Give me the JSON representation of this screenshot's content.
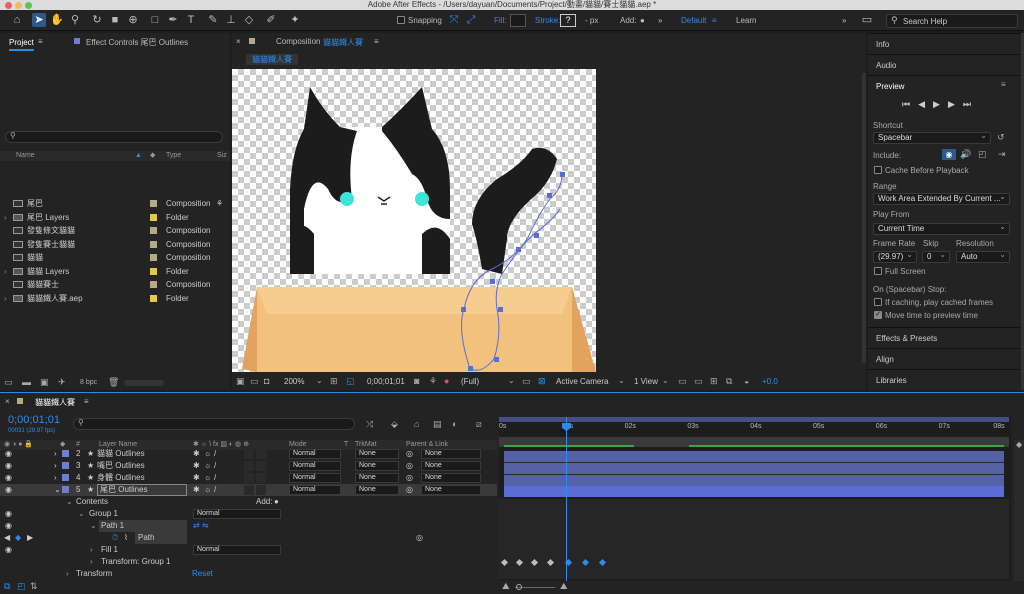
{
  "window": {
    "title": "Adobe After Effects - /Users/dayuan/Documents/Project/動畫/貓貓/賽士貓貓.aep *"
  },
  "toolbar": {
    "snapping": "Snapping",
    "fill": "Fill:",
    "stroke": "Stroke:",
    "stroke_value": "?",
    "px": "- px",
    "add": "Add:",
    "workspace_default": "Default",
    "workspace_learn": "Learn",
    "search_placeholder": "Search Help"
  },
  "project_panel": {
    "tab_project": "Project",
    "tab_effect_controls": "Effect Controls 尾巴 Outlines",
    "col_name": "Name",
    "col_type": "Type",
    "col_size": "Siz",
    "items": [
      {
        "name": "尾巴",
        "type": "Composition",
        "color": "#b5a98c"
      },
      {
        "name": "尾巴 Layers",
        "type": "Folder",
        "color": "#e3c84b"
      },
      {
        "name": "發隻條文貓貓",
        "type": "Composition",
        "color": "#b5a98c"
      },
      {
        "name": "發隻賽士貓貓",
        "type": "Composition",
        "color": "#b5a98c"
      },
      {
        "name": "貓貓",
        "type": "Composition",
        "color": "#b5a98c"
      },
      {
        "name": "貓貓 Layers",
        "type": "Folder",
        "color": "#e3c84b"
      },
      {
        "name": "貓貓賽士",
        "type": "Composition",
        "color": "#b5a98c"
      },
      {
        "name": "貓貓鐵人賽.aep",
        "type": "Folder",
        "color": "#e3c84b"
      }
    ],
    "bpc": "8 bpc"
  },
  "composition_panel": {
    "tab_label": "Composition",
    "tab_comp_name": "貓貓鐵人賽",
    "subtab": "貓貓鐵人賽",
    "zoom": "200%",
    "timecode": "0;00;01;01",
    "resolution": "(Full)",
    "camera": "Active Camera",
    "view": "1 View",
    "exposure": "+0.0"
  },
  "right_panel": {
    "info": "Info",
    "audio": "Audio",
    "preview": "Preview",
    "shortcut_label": "Shortcut",
    "shortcut_value": "Spacebar",
    "include_label": "Include:",
    "cache_before": "Cache Before Playback",
    "range_label": "Range",
    "range_value": "Work Area Extended By Current ...",
    "play_from_label": "Play From",
    "play_from_value": "Current Time",
    "frame_rate_label": "Frame Rate",
    "skip_label": "Skip",
    "resolution_label": "Resolution",
    "frame_rate_value": "(29.97)",
    "skip_value": "0",
    "resolution_value": "Auto",
    "full_screen": "Full Screen",
    "stop_label": "On (Spacebar) Stop:",
    "if_caching": "If caching, play cached frames",
    "move_time": "Move time to preview time",
    "effects_presets": "Effects & Presets",
    "align": "Align",
    "libraries": "Libraries"
  },
  "timeline": {
    "tab": "貓貓鐵人賽",
    "timecode": "0;00;01;01",
    "frame_info": "00031 (29.97 fps)",
    "col_hash": "#",
    "col_layer_name": "Layer Name",
    "col_mode": "Mode",
    "col_t": "T",
    "col_trkmat": "TrkMat",
    "col_parent": "Parent & Link",
    "ruler": [
      "0s",
      "01s",
      "02s",
      "03s",
      "04s",
      "05s",
      "06s",
      "07s",
      "08s"
    ],
    "layers": [
      {
        "num": "2",
        "name": "貓貓 Outlines",
        "mode": "Normal",
        "trkmat": "None",
        "parent": "None",
        "color": "#6f7fd0"
      },
      {
        "num": "3",
        "name": "嘴巴 Outlines",
        "mode": "Normal",
        "trkmat": "None",
        "parent": "None",
        "color": "#6f7fd0"
      },
      {
        "num": "4",
        "name": "身體 Outlines",
        "mode": "Normal",
        "trkmat": "None",
        "parent": "None",
        "color": "#6f7fd0"
      },
      {
        "num": "5",
        "name": "尾巴 Outlines",
        "mode": "Normal",
        "trkmat": "None",
        "parent": "None",
        "color": "#6f7fd0"
      }
    ],
    "contents": "Contents",
    "add": "Add:",
    "group1": "Group 1",
    "group1_mode": "Normal",
    "path1": "Path 1",
    "path": "Path",
    "fill1": "Fill 1",
    "fill1_mode": "Normal",
    "transform_group": "Transform: Group 1",
    "transform": "Transform",
    "reset": "Reset"
  },
  "colors": {
    "accent": "#2d8ceb",
    "box": "#f3c17e",
    "eye": "#3ee4d9"
  }
}
